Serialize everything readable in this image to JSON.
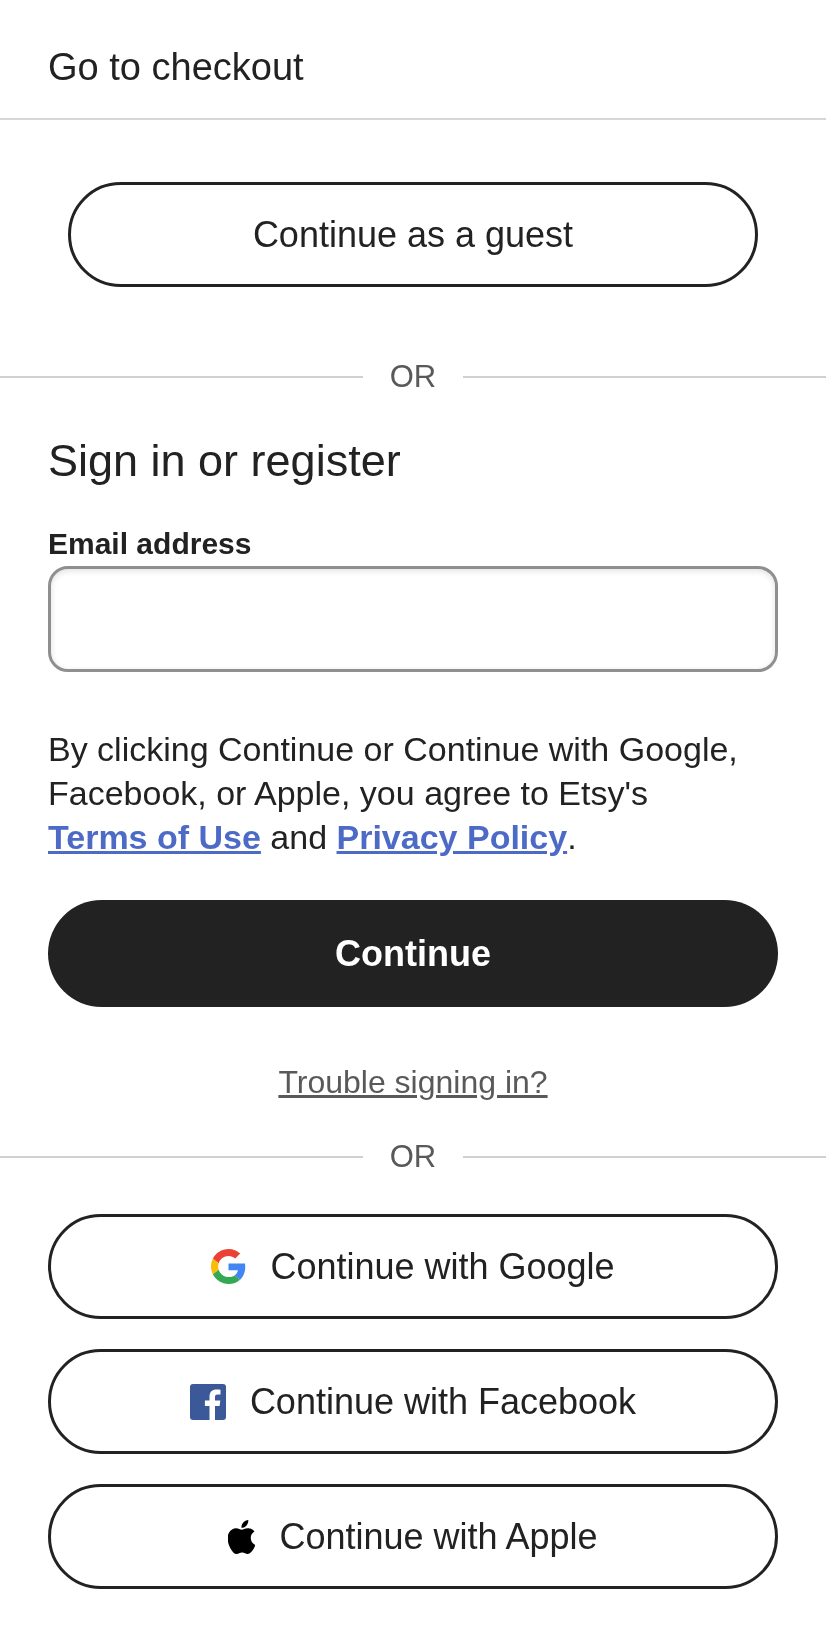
{
  "header": {
    "title": "Go to checkout"
  },
  "guest_button": {
    "label": "Continue as a guest"
  },
  "guest_divider": {
    "label": "OR"
  },
  "sign_in": {
    "heading": "Sign in or register",
    "email_field": {
      "label": "Email address"
    },
    "legal_text": [
      {
        "kind": "text",
        "text": "By clicking Continue or Continue with Google, Facebook, or Apple, you agree to Etsy's "
      },
      {
        "kind": "link",
        "text": "Terms of Use"
      },
      {
        "kind": "text",
        "text": " and "
      },
      {
        "kind": "link",
        "text": "Privacy Policy"
      },
      {
        "kind": "text",
        "text": "."
      }
    ],
    "continue_button": {
      "label": "Continue"
    },
    "help_link": {
      "label": "Trouble signing in?"
    }
  },
  "social_divider": {
    "label": "OR"
  },
  "social_buttons": [
    {
      "kind": "google",
      "label": "Continue with Google"
    },
    {
      "kind": "facebook",
      "label": "Continue with Facebook"
    },
    {
      "kind": "apple",
      "label": "Continue with Apple"
    }
  ]
}
